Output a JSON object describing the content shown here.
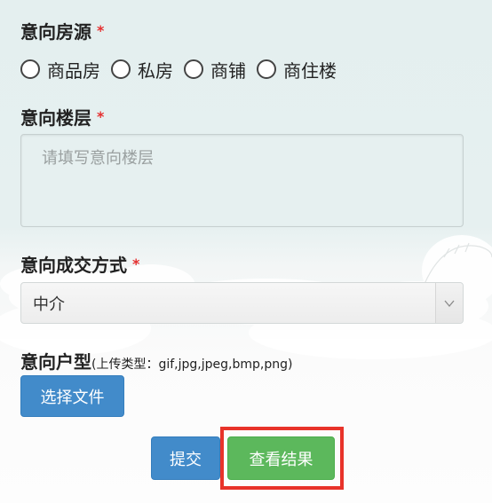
{
  "form": {
    "property_source": {
      "label": "意向房源",
      "required": "*",
      "options": [
        "商品房",
        "私房",
        "商铺",
        "商住楼"
      ]
    },
    "floor": {
      "label": "意向楼层",
      "required": "*",
      "placeholder": "请填写意向楼层",
      "value": ""
    },
    "deal_method": {
      "label": "意向成交方式",
      "required": "*",
      "selected": "中介",
      "arrow_icon": "chevron-down-icon"
    },
    "unit_type": {
      "label": "意向户型",
      "hint": "(上传类型：gif,jpg,jpeg,bmp,png)",
      "choose_file_label": "选择文件"
    },
    "actions": {
      "submit_label": "提交",
      "view_results_label": "查看结果"
    }
  },
  "colors": {
    "required_star": "#e52f2f",
    "primary_button": "#428bca",
    "success_button": "#5cb85c",
    "highlight_box": "#e8332a",
    "background": "#e4efef"
  }
}
